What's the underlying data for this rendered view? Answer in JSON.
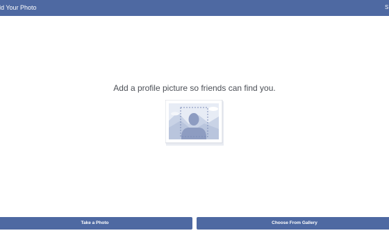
{
  "header": {
    "title": "dd Your Photo",
    "skip_label": "S"
  },
  "main": {
    "prompt": "Add a profile picture so friends can find you.",
    "placeholder_icon": "profile-photo-placeholder-icon"
  },
  "actions": {
    "take_photo_label": "Take a Photo",
    "gallery_label": "Choose From Gallery"
  },
  "colors": {
    "brand": "#4e69a2",
    "background": "#ffffff",
    "text": "#4b4f56"
  }
}
